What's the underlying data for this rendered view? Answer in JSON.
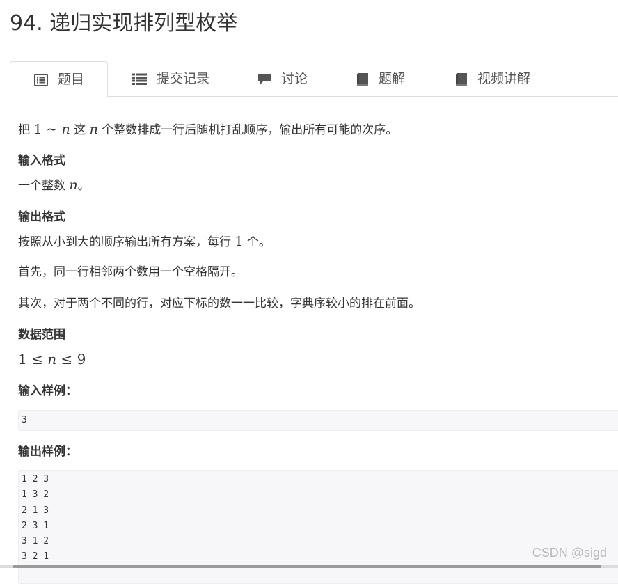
{
  "problem": {
    "title": "94. 递归实现排列型枚举"
  },
  "tabs": [
    {
      "label": "题目",
      "icon": "list-icon",
      "active": true
    },
    {
      "label": "提交记录",
      "icon": "bullet-list-icon",
      "active": false
    },
    {
      "label": "讨论",
      "icon": "comment-icon",
      "active": false
    },
    {
      "label": "题解",
      "icon": "book-icon",
      "active": false
    },
    {
      "label": "视频讲解",
      "icon": "book-icon",
      "active": false
    }
  ],
  "description": {
    "intro_a": "把 ",
    "intro_m1": "1",
    "intro_tilde": " ∼ ",
    "intro_n": "n",
    "intro_b": " 这 ",
    "intro_n2": "n",
    "intro_c": " 个整数排成一行后随机打乱顺序，输出所有可能的次序。"
  },
  "input_format": {
    "heading": "输入格式",
    "text_a": "一个整数 ",
    "text_n": "n",
    "text_b": "。"
  },
  "output_format": {
    "heading": "输出格式",
    "line1_a": "按照从小到大的顺序输出所有方案，每行 ",
    "line1_m": "1",
    "line1_b": " 个。",
    "line2": "首先，同一行相邻两个数用一个空格隔开。",
    "line3": "其次，对于两个不同的行，对应下标的数一一比较，字典序较小的排在前面。"
  },
  "data_range": {
    "heading": "数据范围",
    "formula_1": "1",
    "formula_le1": " ≤ ",
    "formula_n": "n",
    "formula_le2": " ≤ ",
    "formula_9": "9"
  },
  "sample_input": {
    "heading": "输入样例：",
    "lines": [
      "3"
    ]
  },
  "sample_output": {
    "heading": "输出样例：",
    "lines": [
      "1 2 3",
      "1 3 2",
      "2 1 3",
      "2 3 1",
      "3 1 2",
      "3 2 1"
    ]
  },
  "watermark": "CSDN @sigd"
}
